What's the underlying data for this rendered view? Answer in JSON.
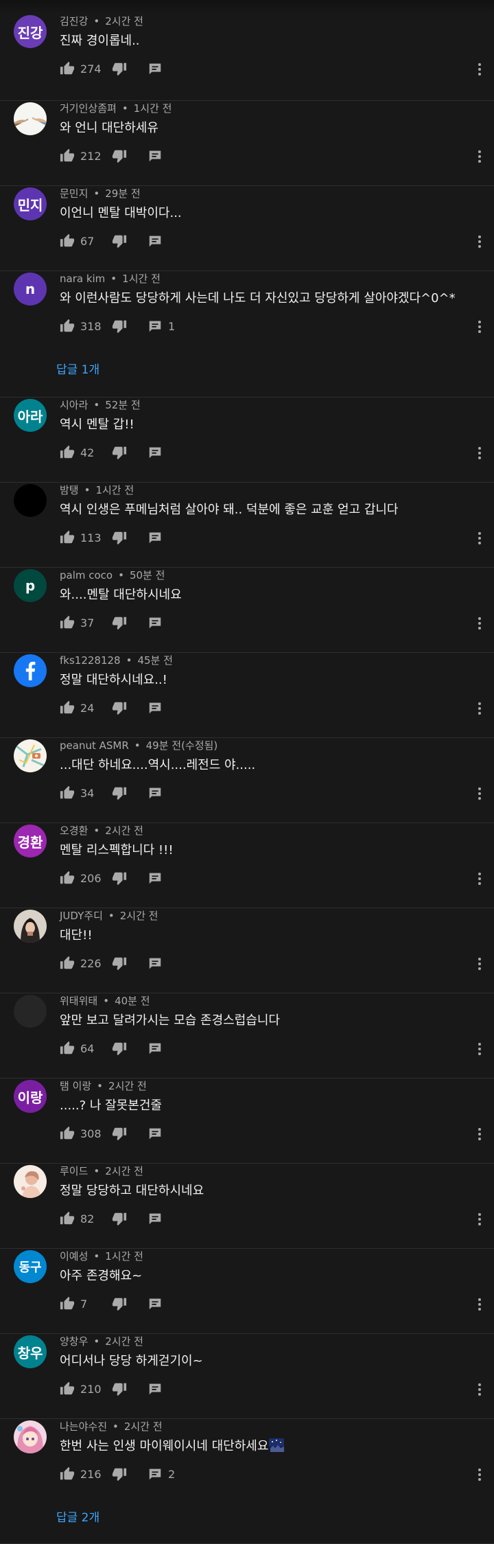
{
  "comments": [
    {
      "author": "김진강",
      "time": "2시간 전",
      "text": "진짜 경이롭네..",
      "likes": "274",
      "avatar": {
        "type": "text",
        "text": "진강",
        "color": "#6a3cb5"
      }
    },
    {
      "author": "거기인상좀펴",
      "time": "1시간 전",
      "text": "와 언니 대단하세유",
      "likes": "212",
      "avatar": {
        "type": "image",
        "icon": "hands-painting-icon"
      }
    },
    {
      "author": "문민지",
      "time": "29분 전",
      "text": "이언니 멘탈 대박이다...",
      "likes": "67",
      "avatar": {
        "type": "text",
        "text": "민지",
        "color": "#5e35b1"
      }
    },
    {
      "author": "nara kim",
      "time": "1시간 전",
      "text": "와 이런사람도 당당하게 사는데 나도 더 자신있고 당당하게 살아야겠다^0^*",
      "likes": "318",
      "reply_count": "1",
      "replies_label": "답글 1개",
      "avatar": {
        "type": "text",
        "text": "n",
        "color": "#5e35b1"
      }
    },
    {
      "author": "시아라",
      "time": "52분 전",
      "text": "역시 멘탈 갑!!",
      "likes": "42",
      "avatar": {
        "type": "text",
        "text": "아라",
        "color": "#00838f"
      }
    },
    {
      "author": "밤탱",
      "time": "1시간 전",
      "text": "역시 인생은 푸메님처럼 살아야 돼.. 덕분에 좋은 교훈 얻고 갑니다",
      "likes": "113",
      "avatar": {
        "type": "image",
        "icon": "black-avatar-icon"
      }
    },
    {
      "author": "palm coco",
      "time": "50분 전",
      "text": "와....멘탈 대단하시네요",
      "likes": "37",
      "avatar": {
        "type": "text",
        "text": "p",
        "color": "#00493f"
      }
    },
    {
      "author": "fks1228128",
      "time": "45분 전",
      "text": "정말 대단하시네요..!",
      "likes": "24",
      "avatar": {
        "type": "image",
        "icon": "facebook-icon",
        "color": "#1877f2"
      }
    },
    {
      "author": "peanut ASMR",
      "time": "49분 전(수정됨)",
      "text": "...대단 하네요....역시....레전드 야.....",
      "likes": "34",
      "avatar": {
        "type": "image",
        "icon": "peanut-map-icon"
      }
    },
    {
      "author": "오경환",
      "time": "2시간 전",
      "text": "멘탈 리스펙합니다 !!!",
      "likes": "206",
      "avatar": {
        "type": "text",
        "text": "경환",
        "color": "#9c27b0"
      }
    },
    {
      "author": "JUDY주디",
      "time": "2시간 전",
      "text": "대단!!",
      "likes": "226",
      "avatar": {
        "type": "image",
        "icon": "person-photo-icon"
      }
    },
    {
      "author": "위태위태",
      "time": "40분 전",
      "text": "앞만 보고 달려가시는 모습 존경스럽습니다",
      "likes": "64",
      "avatar": {
        "type": "image",
        "icon": "dark-avatar-icon"
      }
    },
    {
      "author": "탬 이랑",
      "time": "2시간 전",
      "text": ".....? 나 잘못본건줄",
      "likes": "308",
      "avatar": {
        "type": "text",
        "text": "이랑",
        "color": "#7b1fa2"
      }
    },
    {
      "author": "루이드",
      "time": "2시간 전",
      "text": "정말 당당하고 대단하시네요",
      "likes": "82",
      "avatar": {
        "type": "image",
        "icon": "illustration-avatar-icon"
      }
    },
    {
      "author": "이예성",
      "time": "1시간 전",
      "text": "아주 존경해요~",
      "likes": "7",
      "avatar": {
        "type": "image",
        "icon": "donggu-logo-icon",
        "text": "동구",
        "color": "#0288d1"
      }
    },
    {
      "author": "양창우",
      "time": "2시간 전",
      "text": "어디서나 당당 하게걷기이~",
      "likes": "210",
      "avatar": {
        "type": "text",
        "text": "창우",
        "color": "#00838f"
      }
    },
    {
      "author": "나는야수진",
      "time": "2시간 전",
      "text": "한번 사는 인생 마이웨이시네 대단하세요",
      "likes": "216",
      "reply_count": "2",
      "replies_label": "답글 2개",
      "emoji": "night-sky-emoji-icon",
      "avatar": {
        "type": "image",
        "icon": "anime-girl-icon"
      }
    }
  ],
  "icons": {
    "like": "thumb-up-icon",
    "dislike": "thumb-down-icon",
    "reply": "comment-icon",
    "more": "more-vert-icon"
  },
  "colors": {
    "background": "#181818",
    "divider": "#2e2e2e",
    "primary_text": "#f1f1f1",
    "secondary_text": "#aaaaaa",
    "link": "#3ea6ff"
  }
}
